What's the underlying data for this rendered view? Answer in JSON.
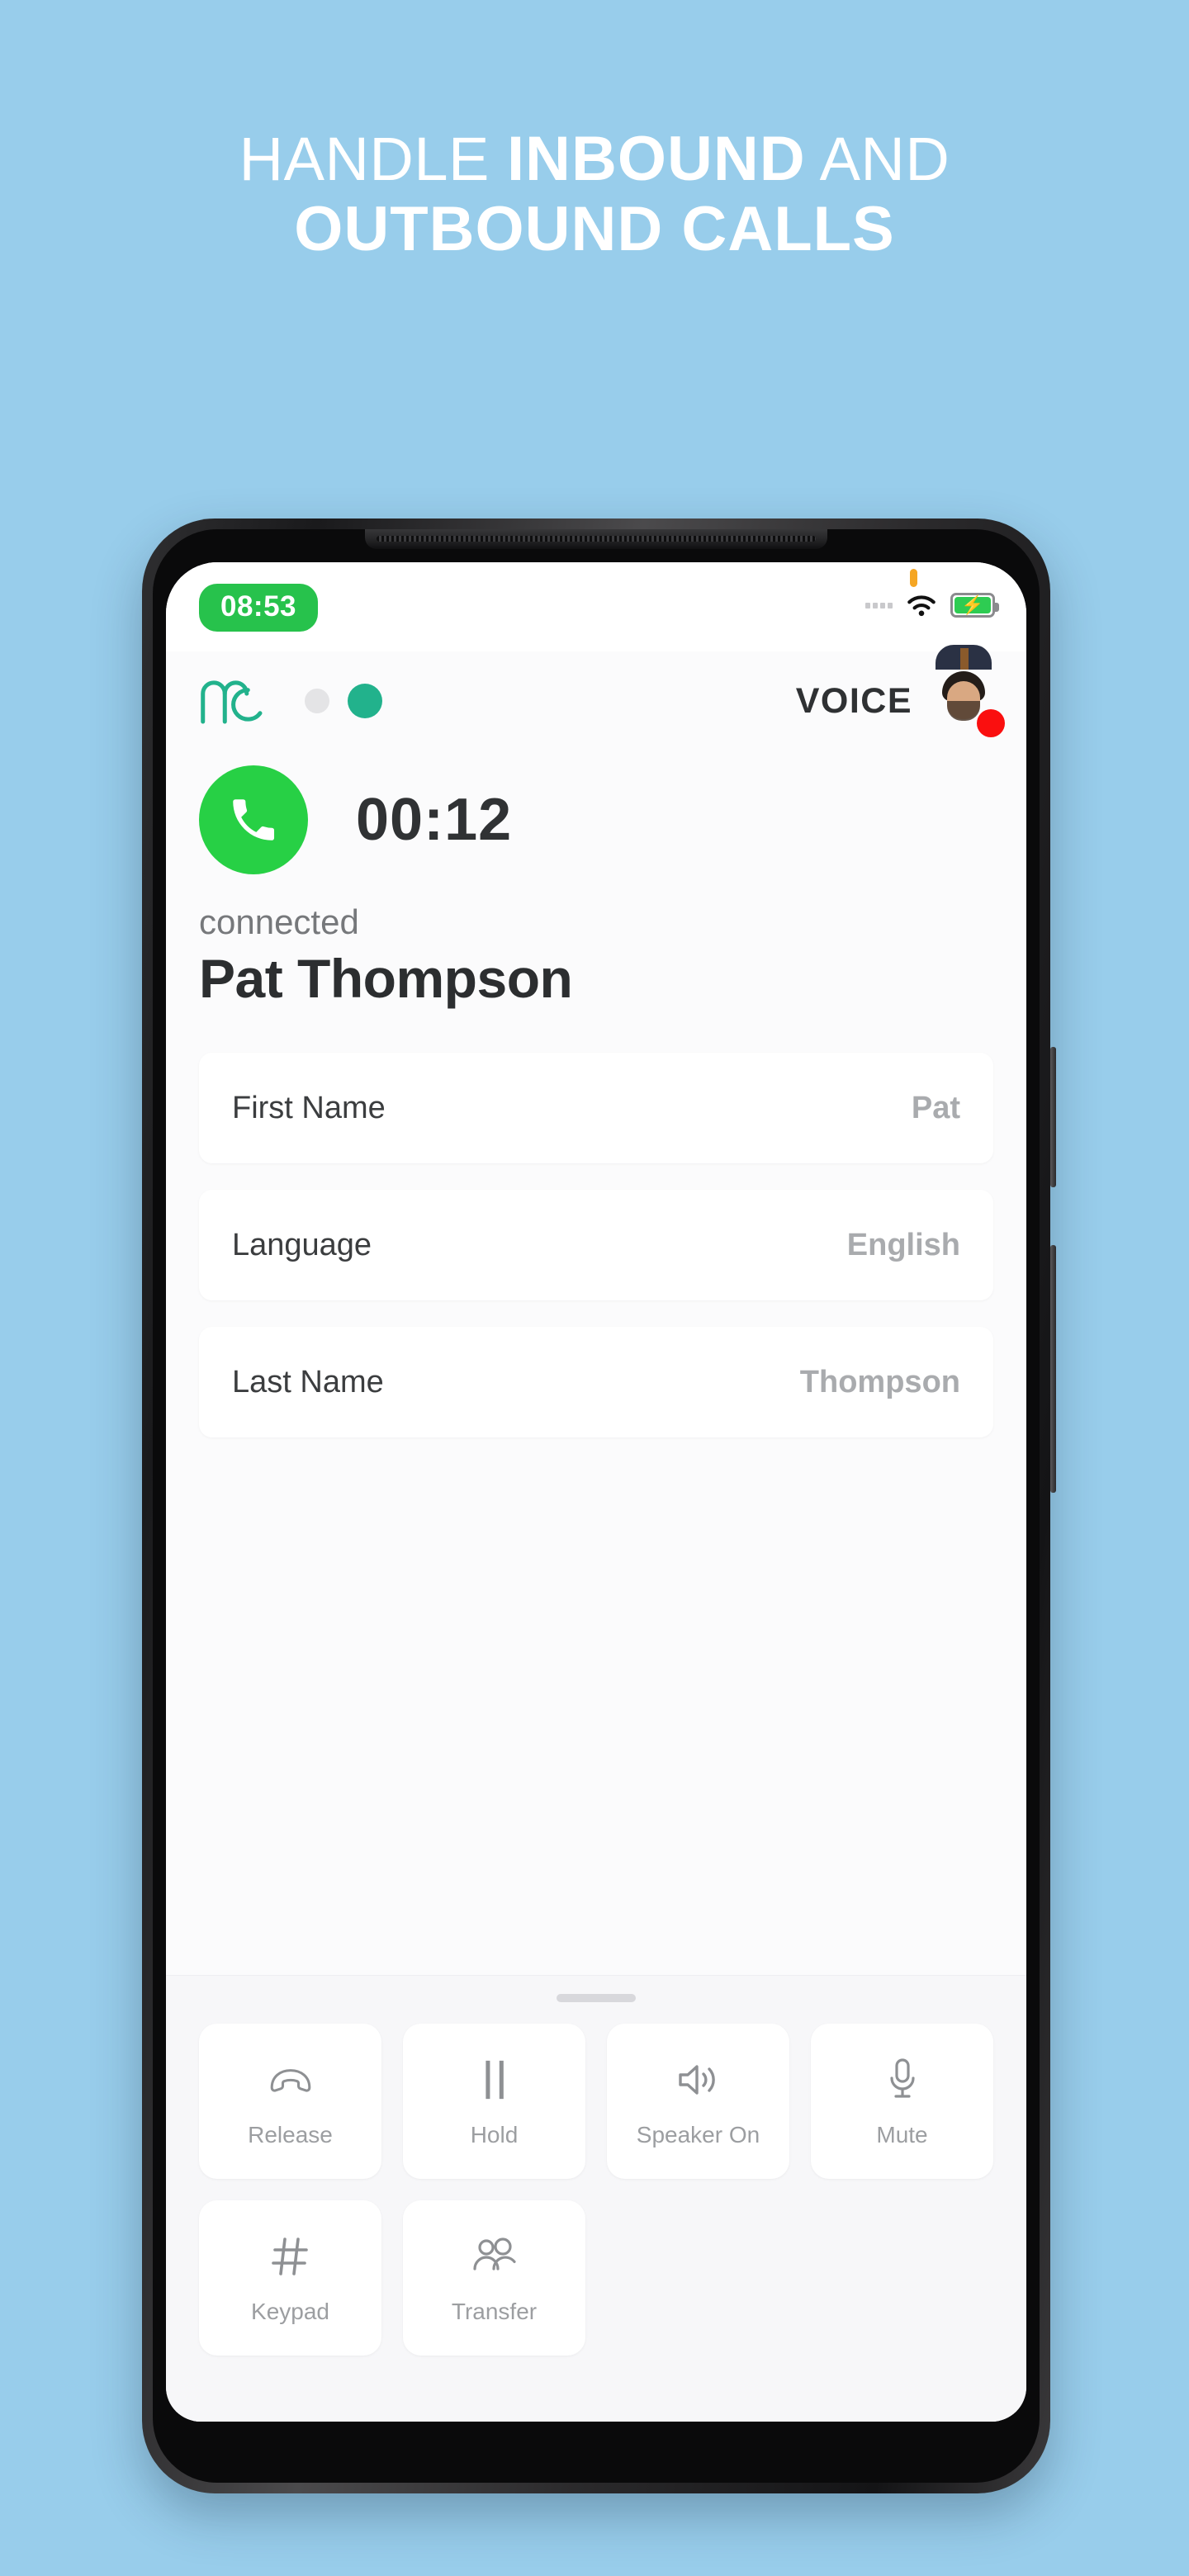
{
  "promo": {
    "line1_light_a": "HANDLE ",
    "line1_bold": "INBOUND",
    "line1_light_b": " AND",
    "line2_bold": "OUTBOUND CALLS"
  },
  "colors": {
    "background": "#98cdeb",
    "accent_green": "#27d045",
    "accent_teal": "#22b28c",
    "status_red": "#fa0f0f",
    "battery_green": "#2ecc52",
    "time_pill_green": "#27c24c"
  },
  "status_bar": {
    "time": "08:53",
    "notification_dot": "orange-dot-icon",
    "signal": "signal-dots-icon",
    "wifi": "wifi-icon",
    "battery": "battery-charging-icon"
  },
  "app_header": {
    "logo": "mc-logo-icon",
    "dot_inactive": "status-dot-inactive",
    "dot_active": "status-dot-active",
    "mode_label": "VOICE",
    "avatar": "agent-avatar",
    "avatar_badge": "recording-badge-icon"
  },
  "call": {
    "call_icon": "phone-handset-icon",
    "timer": "00:12",
    "status": "connected",
    "contact_name": "Pat Thompson"
  },
  "info_rows": [
    {
      "label": "First Name",
      "value": "Pat"
    },
    {
      "label": "Language",
      "value": "English"
    },
    {
      "label": "Last Name",
      "value": "Thompson"
    }
  ],
  "sheet": {
    "grabber": "drag-handle",
    "actions_row1": [
      {
        "label": "Release",
        "icon": "call-end-icon"
      },
      {
        "label": "Hold",
        "icon": "pause-icon"
      },
      {
        "label": "Speaker On",
        "icon": "speaker-icon"
      },
      {
        "label": "Mute",
        "icon": "microphone-icon"
      }
    ],
    "actions_row2": [
      {
        "label": "Keypad",
        "icon": "hash-keypad-icon"
      },
      {
        "label": "Transfer",
        "icon": "people-transfer-icon"
      }
    ]
  }
}
